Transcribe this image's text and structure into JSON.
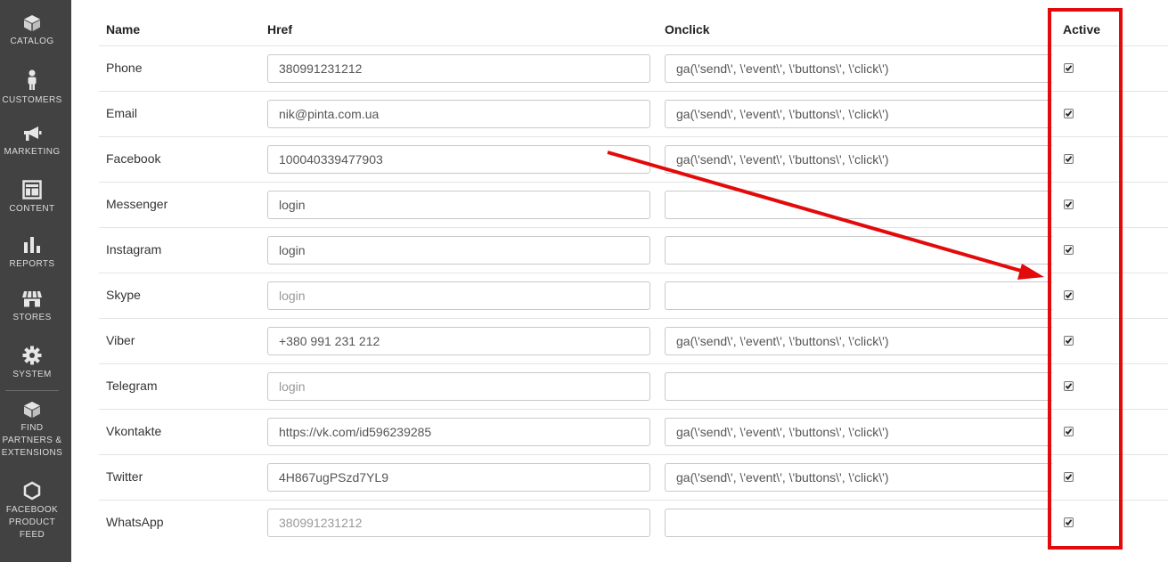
{
  "sidebar": {
    "items": [
      {
        "label": "CATALOG",
        "icon": "cube-icon"
      },
      {
        "label": "CUSTOMERS",
        "icon": "person-icon"
      },
      {
        "label": "MARKETING",
        "icon": "megaphone-icon"
      },
      {
        "label": "CONTENT",
        "icon": "layout-icon"
      },
      {
        "label": "REPORTS",
        "icon": "bar-chart-icon"
      },
      {
        "label": "STORES",
        "icon": "storefront-icon"
      },
      {
        "label": "SYSTEM",
        "icon": "gear-icon"
      },
      {
        "label": "FIND PARTNERS & EXTENSIONS",
        "lines": [
          "FIND",
          "PARTNERS &",
          "EXTENSIONS"
        ],
        "icon": "cube-icon"
      },
      {
        "label": "FACEBOOK PRODUCT FEED",
        "lines": [
          "FACEBOOK",
          "PRODUCT",
          "FEED"
        ],
        "icon": "hexagon-icon"
      }
    ]
  },
  "table": {
    "headers": {
      "name": "Name",
      "href": "Href",
      "onclick": "Onclick",
      "active": "Active"
    },
    "rows": [
      {
        "name": "Phone",
        "href": "380991231212",
        "href_placeholder": false,
        "onclick": "ga(\\'send\\', \\'event\\', \\'buttons\\', \\'click\\')",
        "active": true
      },
      {
        "name": "Email",
        "href": "nik@pinta.com.ua",
        "href_placeholder": false,
        "onclick": "ga(\\'send\\', \\'event\\', \\'buttons\\', \\'click\\')",
        "active": true
      },
      {
        "name": "Facebook",
        "href": "100040339477903",
        "href_placeholder": false,
        "onclick": "ga(\\'send\\', \\'event\\', \\'buttons\\', \\'click\\')",
        "active": true
      },
      {
        "name": "Messenger",
        "href": "login",
        "href_placeholder": false,
        "onclick": "",
        "active": true
      },
      {
        "name": "Instagram",
        "href": "login",
        "href_placeholder": false,
        "onclick": "",
        "active": true
      },
      {
        "name": "Skype",
        "href": "login",
        "href_placeholder": true,
        "onclick": "",
        "active": true
      },
      {
        "name": "Viber",
        "href": "+380 991 231 212",
        "href_placeholder": false,
        "onclick": "ga(\\'send\\', \\'event\\', \\'buttons\\', \\'click\\')",
        "active": true
      },
      {
        "name": "Telegram",
        "href": "login",
        "href_placeholder": true,
        "onclick": "",
        "active": true
      },
      {
        "name": "Vkontakte",
        "href": "https://vk.com/id596239285",
        "href_placeholder": false,
        "onclick": "ga(\\'send\\', \\'event\\', \\'buttons\\', \\'click\\')",
        "active": true
      },
      {
        "name": "Twitter",
        "href": "4H867ugPSzd7YL9",
        "href_placeholder": false,
        "onclick": "ga(\\'send\\', \\'event\\', \\'buttons\\', \\'click\\')",
        "active": true
      },
      {
        "name": "WhatsApp",
        "href": "380991231212",
        "href_placeholder": true,
        "onclick": "",
        "active": true
      }
    ]
  },
  "annotation": {
    "color": "#e20a0a"
  }
}
